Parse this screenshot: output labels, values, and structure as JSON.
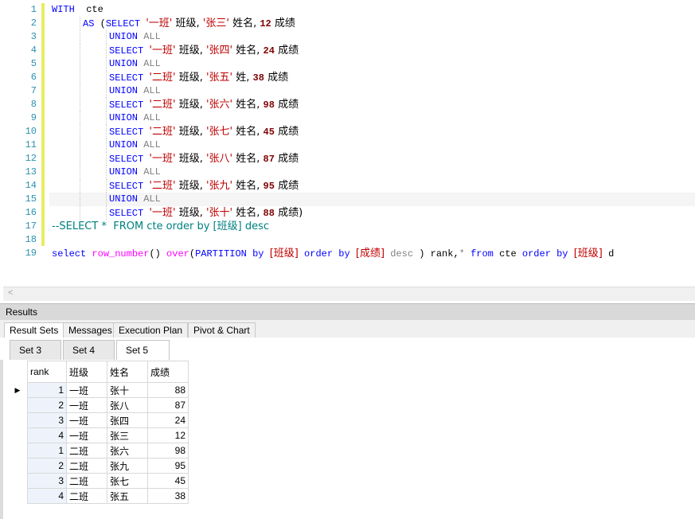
{
  "editor": {
    "lines": [
      {
        "n": "1",
        "indent": 0,
        "tokens": [
          [
            "kw",
            "WITH"
          ],
          [
            "",
            "  cte"
          ]
        ]
      },
      {
        "n": "2",
        "indent": 1,
        "tokens": [
          [
            "kw",
            "AS"
          ],
          [
            "",
            " ("
          ],
          [
            "kw",
            "SELECT"
          ],
          [
            "",
            " "
          ],
          [
            "str",
            "'一班'"
          ],
          [
            "",
            " 班级, "
          ],
          [
            "str",
            "'张三'"
          ],
          [
            "",
            " 姓名, "
          ],
          [
            "num",
            "12"
          ],
          [
            "",
            " 成绩"
          ]
        ]
      },
      {
        "n": "3",
        "indent": 2,
        "tokens": [
          [
            "kw",
            "UNION"
          ],
          [
            "",
            " "
          ],
          [
            "gray",
            "ALL"
          ]
        ]
      },
      {
        "n": "4",
        "indent": 2,
        "tokens": [
          [
            "kw",
            "SELECT"
          ],
          [
            "",
            " "
          ],
          [
            "str",
            "'一班'"
          ],
          [
            "",
            " 班级, "
          ],
          [
            "str",
            "'张四'"
          ],
          [
            "",
            " 姓名, "
          ],
          [
            "num",
            "24"
          ],
          [
            "",
            " 成绩"
          ]
        ]
      },
      {
        "n": "5",
        "indent": 2,
        "tokens": [
          [
            "kw",
            "UNION"
          ],
          [
            "",
            " "
          ],
          [
            "gray",
            "ALL"
          ]
        ]
      },
      {
        "n": "6",
        "indent": 2,
        "tokens": [
          [
            "kw",
            "SELECT"
          ],
          [
            "",
            " "
          ],
          [
            "str",
            "'二班'"
          ],
          [
            "",
            " 班级, "
          ],
          [
            "str",
            "'张五'"
          ],
          [
            "",
            " 姓, "
          ],
          [
            "num",
            "38"
          ],
          [
            "",
            " 成绩"
          ]
        ]
      },
      {
        "n": "7",
        "indent": 2,
        "tokens": [
          [
            "kw",
            "UNION"
          ],
          [
            "",
            " "
          ],
          [
            "gray",
            "ALL"
          ]
        ]
      },
      {
        "n": "8",
        "indent": 2,
        "tokens": [
          [
            "kw",
            "SELECT"
          ],
          [
            "",
            " "
          ],
          [
            "str",
            "'二班'"
          ],
          [
            "",
            " 班级, "
          ],
          [
            "str",
            "'张六'"
          ],
          [
            "",
            " 姓名, "
          ],
          [
            "num",
            "98"
          ],
          [
            "",
            " 成绩"
          ]
        ]
      },
      {
        "n": "9",
        "indent": 2,
        "tokens": [
          [
            "kw",
            "UNION"
          ],
          [
            "",
            " "
          ],
          [
            "gray",
            "ALL"
          ]
        ]
      },
      {
        "n": "10",
        "indent": 2,
        "tokens": [
          [
            "kw",
            "SELECT"
          ],
          [
            "",
            " "
          ],
          [
            "str",
            "'二班'"
          ],
          [
            "",
            " 班级, "
          ],
          [
            "str",
            "'张七'"
          ],
          [
            "",
            " 姓名, "
          ],
          [
            "num",
            "45"
          ],
          [
            "",
            " 成绩"
          ]
        ]
      },
      {
        "n": "11",
        "indent": 2,
        "tokens": [
          [
            "kw",
            "UNION"
          ],
          [
            "",
            " "
          ],
          [
            "gray",
            "ALL"
          ]
        ]
      },
      {
        "n": "12",
        "indent": 2,
        "tokens": [
          [
            "kw",
            "SELECT"
          ],
          [
            "",
            " "
          ],
          [
            "str",
            "'一班'"
          ],
          [
            "",
            " 班级, "
          ],
          [
            "str",
            "'张八'"
          ],
          [
            "",
            " 姓名, "
          ],
          [
            "num",
            "87"
          ],
          [
            "",
            " 成绩"
          ]
        ]
      },
      {
        "n": "13",
        "indent": 2,
        "tokens": [
          [
            "kw",
            "UNION"
          ],
          [
            "",
            " "
          ],
          [
            "gray",
            "ALL"
          ]
        ]
      },
      {
        "n": "14",
        "indent": 2,
        "tokens": [
          [
            "kw",
            "SELECT"
          ],
          [
            "",
            " "
          ],
          [
            "str",
            "'二班'"
          ],
          [
            "",
            " 班级, "
          ],
          [
            "str",
            "'张九'"
          ],
          [
            "",
            " 姓名, "
          ],
          [
            "num",
            "95"
          ],
          [
            "",
            " 成绩"
          ]
        ]
      },
      {
        "n": "15",
        "indent": 2,
        "current": true,
        "tokens": [
          [
            "kw",
            "UNION"
          ],
          [
            "",
            " "
          ],
          [
            "gray",
            "ALL"
          ]
        ]
      },
      {
        "n": "16",
        "indent": 2,
        "tokens": [
          [
            "kw",
            "SELECT"
          ],
          [
            "",
            " "
          ],
          [
            "str",
            "'一班'"
          ],
          [
            "",
            " 班级, "
          ],
          [
            "str",
            "'张十'"
          ],
          [
            "",
            " 姓名, "
          ],
          [
            "num",
            "88"
          ],
          [
            "",
            " 成绩)"
          ]
        ]
      },
      {
        "n": "17",
        "indent": 0,
        "tokens": [
          [
            "cm",
            "--SELECT *  FROM cte order by [班级] desc"
          ]
        ]
      },
      {
        "n": "18",
        "indent": 0,
        "tokens": []
      },
      {
        "n": "19",
        "indent": 0,
        "tokens": [
          [
            "kw",
            "select"
          ],
          [
            "",
            " "
          ],
          [
            "fn",
            "row_number"
          ],
          [
            "",
            "() "
          ],
          [
            "fn",
            "over"
          ],
          [
            "",
            "("
          ],
          [
            "kw",
            "PARTITION"
          ],
          [
            "",
            " "
          ],
          [
            "kw",
            "by"
          ],
          [
            "",
            " "
          ],
          [
            "str",
            "[班级]"
          ],
          [
            "",
            " "
          ],
          [
            "kw",
            "order"
          ],
          [
            "",
            " "
          ],
          [
            "kw",
            "by"
          ],
          [
            "",
            " "
          ],
          [
            "str",
            "[成绩]"
          ],
          [
            "",
            " "
          ],
          [
            "gray",
            "desc"
          ],
          [
            "",
            " ) rank,"
          ],
          [
            "gray",
            "*"
          ],
          [
            "",
            " "
          ],
          [
            "kw",
            "from"
          ],
          [
            "",
            " cte "
          ],
          [
            "kw",
            "order"
          ],
          [
            "",
            " "
          ],
          [
            "kw",
            "by"
          ],
          [
            "",
            " "
          ],
          [
            "str",
            "[班级]"
          ],
          [
            "",
            " d"
          ]
        ]
      }
    ]
  },
  "results": {
    "panel_title": "Results",
    "main_tabs": [
      "Result Sets",
      "Messages",
      "Execution Plan",
      "Pivot & Chart"
    ],
    "set_tabs": [
      "Set 3",
      "Set 4",
      "Set 5"
    ],
    "columns": [
      "rank",
      "班级",
      "姓名",
      "成绩"
    ],
    "rows": [
      [
        "1",
        "一班",
        "张十",
        "88"
      ],
      [
        "2",
        "一班",
        "张八",
        "87"
      ],
      [
        "3",
        "一班",
        "张四",
        "24"
      ],
      [
        "4",
        "一班",
        "张三",
        "12"
      ],
      [
        "1",
        "二班",
        "张六",
        "98"
      ],
      [
        "2",
        "二班",
        "张九",
        "95"
      ],
      [
        "3",
        "二班",
        "张七",
        "45"
      ],
      [
        "4",
        "二班",
        "张五",
        "38"
      ]
    ]
  },
  "colors": {
    "keyword": "#0000ff",
    "string": "#c00000",
    "number": "#800000",
    "function": "#ff00ff",
    "comment": "#008080",
    "line_number": "#2b91af",
    "change_bar": "#e8ec61"
  },
  "icons": {
    "scroll_left": "chevron-left-icon",
    "row_indicator": "current-row-triangle-icon"
  }
}
